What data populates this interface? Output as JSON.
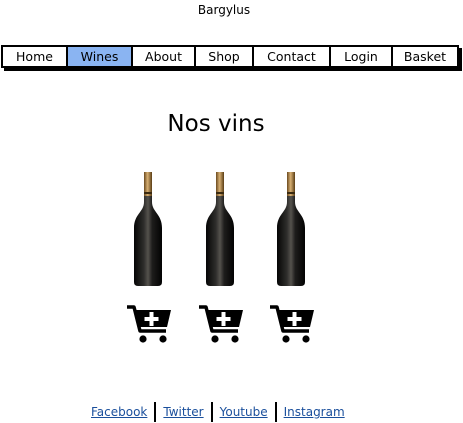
{
  "site": {
    "title": "Bargylus"
  },
  "nav": {
    "items": [
      {
        "label": "Home"
      },
      {
        "label": "Wines"
      },
      {
        "label": "About"
      },
      {
        "label": "Shop"
      },
      {
        "label": "Contact"
      },
      {
        "label": "Login"
      },
      {
        "label": "Basket"
      }
    ],
    "active": "Wines",
    "active_color": "#8ab4f2"
  },
  "main": {
    "heading": "Nos vins",
    "products": [
      {
        "image": "wine-bottle",
        "action_icon": "add-to-cart-icon"
      },
      {
        "image": "wine-bottle",
        "action_icon": "add-to-cart-icon"
      },
      {
        "image": "wine-bottle",
        "action_icon": "add-to-cart-icon"
      }
    ]
  },
  "footer": {
    "links": [
      "Facebook",
      "Twitter",
      "Youtube",
      "Instagram"
    ],
    "link_color": "#1a4f9c"
  }
}
